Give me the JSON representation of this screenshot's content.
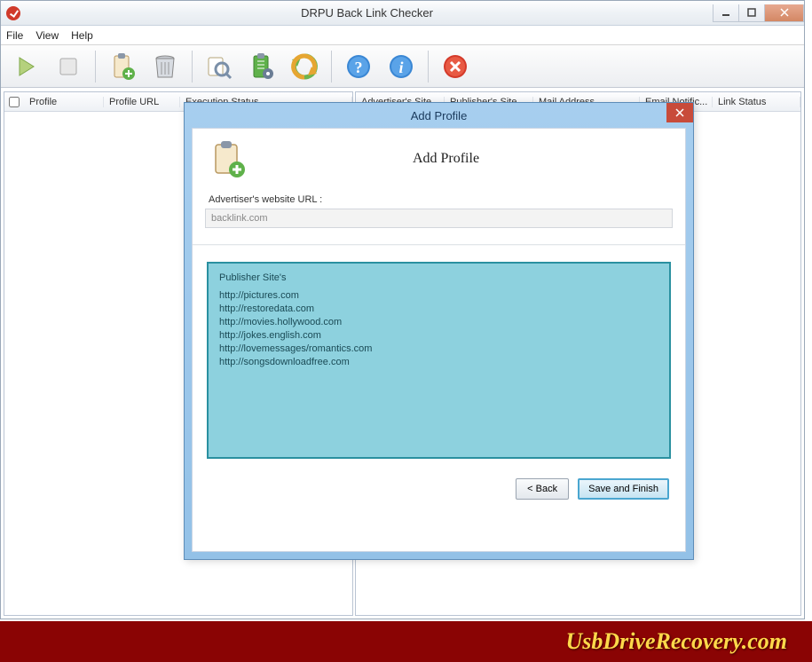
{
  "window": {
    "title": "DRPU Back Link Checker"
  },
  "menu": {
    "file": "File",
    "view": "View",
    "help": "Help"
  },
  "columns_left": {
    "profile": "Profile",
    "profile_url": "Profile URL",
    "execution_status": "Execution Status"
  },
  "columns_right": {
    "advertiser_site": "Advertiser's Site",
    "publisher_site": "Publisher's Site",
    "mail_address": "Mail Address",
    "email_notific": "Email Notific...",
    "link_status": "Link Status"
  },
  "dialog": {
    "title": "Add Profile",
    "heading": "Add Profile",
    "field_label": "Advertiser's website URL :",
    "field_value": "backlink.com",
    "publisher_title": "Publisher Site's",
    "publisher_items": [
      "http://pictures.com",
      "http://restoredata.com",
      "http://movies.hollywood.com",
      "http://jokes.english.com",
      "http://lovemessages/romantics.com",
      "http://songsdownloadfree.com"
    ],
    "back_btn": "< Back",
    "save_btn": "Save and Finish"
  },
  "watermark": "UsbDriveRecovery.com"
}
